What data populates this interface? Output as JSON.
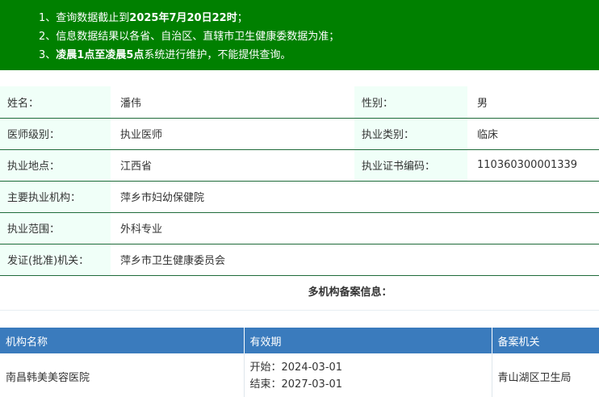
{
  "notice": {
    "line1_prefix": "1、查询数据截止到",
    "line1_bold": "2025年7月20日22时",
    "line1_suffix": "；",
    "line2": "2、信息数据结果以各省、自治区、直辖市卫生健康委数据为准；",
    "line3_prefix": "3、",
    "line3_bold": "凌晨1点至凌晨5点",
    "line3_suffix": "系统进行维护，不能提供查询。"
  },
  "doctor": {
    "name_label": "姓名：",
    "name": "潘伟",
    "gender_label": "性别：",
    "gender": "男",
    "level_label": "医师级别：",
    "level": "执业医师",
    "category_label": "执业类别：",
    "category": "临床",
    "location_label": "执业地点：",
    "location": "江西省",
    "cert_label": "执业证书编码：",
    "cert_no": "110360300001339",
    "institution_label": "主要执业机构：",
    "institution": "萍乡市妇幼保健院",
    "scope_label": "执业范围：",
    "scope": "外科专业",
    "issuer_label": "发证(批准)机关：",
    "issuer": "萍乡市卫生健康委员会"
  },
  "multi": {
    "title": "多机构备案信息：",
    "headers": {
      "name": "机构名称",
      "validity": "有效期",
      "authority": "备案机关"
    },
    "rows": [
      {
        "name": "南昌韩美美容医院",
        "start": "开始：2024-03-01",
        "end": "结束：2027-03-01",
        "authority": "青山湖区卫生局"
      }
    ]
  }
}
